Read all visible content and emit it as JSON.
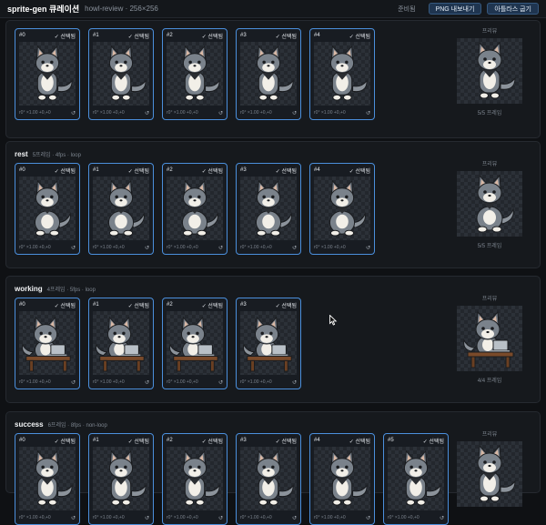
{
  "app": {
    "title": "sprite-gen 큐레이션",
    "subtitle": "howl-review · 256×256",
    "status": "준비됨",
    "export_label": "PNG 내보내기",
    "atlas_label": "아틀라스 굽기"
  },
  "frame_text": {
    "selected": "✓ 선택됨",
    "meta": "r0° ×1.00 +0,+0",
    "reset": "↺"
  },
  "colors": {
    "accent": "#4b8fdc",
    "background": "#0f1114",
    "panel": "#16191d"
  },
  "sections": [
    {
      "name": "",
      "meta": "",
      "pose": "stand",
      "preview_title": "프리뷰",
      "preview_count": "5/5 프레임",
      "frames": [
        {
          "index": "#0"
        },
        {
          "index": "#1"
        },
        {
          "index": "#2"
        },
        {
          "index": "#3"
        },
        {
          "index": "#4"
        }
      ]
    },
    {
      "name": "rest",
      "meta": "5프레임 · 4fps · loop",
      "pose": "sit",
      "preview_title": "프리뷰",
      "preview_count": "5/5 프레임",
      "frames": [
        {
          "index": "#0"
        },
        {
          "index": "#1"
        },
        {
          "index": "#2"
        },
        {
          "index": "#3"
        },
        {
          "index": "#4"
        }
      ]
    },
    {
      "name": "working",
      "meta": "4프레임 · 5fps · loop",
      "pose": "laptop",
      "preview_title": "프리뷰",
      "preview_count": "4/4 프레임",
      "frames": [
        {
          "index": "#0"
        },
        {
          "index": "#1"
        },
        {
          "index": "#2"
        },
        {
          "index": "#3"
        }
      ]
    },
    {
      "name": "success",
      "meta": "6프레임 · 8fps · non-loop",
      "pose": "stand",
      "preview_title": "프리뷰",
      "preview_count": "",
      "frames": [
        {
          "index": "#0"
        },
        {
          "index": "#1"
        },
        {
          "index": "#2"
        },
        {
          "index": "#3"
        },
        {
          "index": "#4"
        },
        {
          "index": "#5"
        }
      ]
    }
  ]
}
